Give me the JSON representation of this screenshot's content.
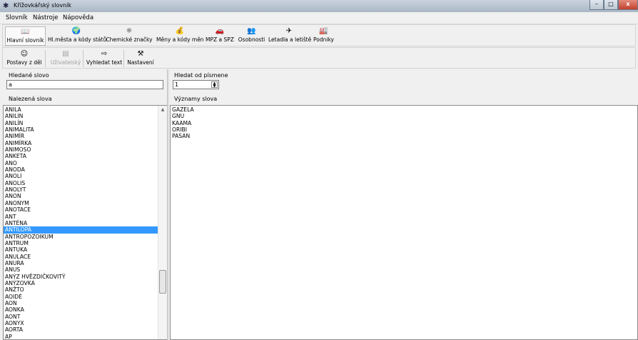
{
  "window": {
    "title": "Křížovkářský slovník",
    "minimize": "–",
    "maximize": "□",
    "close": "x"
  },
  "menu": [
    "Slovník",
    "Nástroje",
    "Nápověda"
  ],
  "toolbar1": [
    {
      "label": "Hlavní slovník",
      "icon": "book-icon",
      "glyph": "📖"
    },
    {
      "label": "Hl.města a kódy států",
      "icon": "globe-icon",
      "glyph": "🌍"
    },
    {
      "label": "Chemické značky",
      "icon": "atom-icon",
      "glyph": "⚛"
    },
    {
      "label": "Měny a kódy měn",
      "icon": "money-bag-icon",
      "glyph": "💰"
    },
    {
      "label": "MPZ a SPZ",
      "icon": "car-icon",
      "glyph": "🚗"
    },
    {
      "label": "Osobnosti",
      "icon": "people-icon",
      "glyph": "👥"
    },
    {
      "label": "Letadla a letiště",
      "icon": "airplane-icon",
      "glyph": "✈"
    },
    {
      "label": "Podniky",
      "icon": "factory-icon",
      "glyph": "🏭"
    }
  ],
  "toolbar2": [
    {
      "label": "Postavy z děl",
      "icon": "character-icon",
      "glyph": "☺"
    },
    {
      "label": "Uživatelský",
      "icon": "user-dictionary-icon",
      "glyph": "▤"
    },
    {
      "label": "Vyhledat text",
      "icon": "search-text-icon",
      "glyph": "⇨"
    },
    {
      "label": "Nastavení",
      "icon": "settings-tools-icon",
      "glyph": "⚒"
    }
  ],
  "search": {
    "label": "Hledané slovo",
    "value": "a"
  },
  "start_letter": {
    "label": "Hledat od písmene",
    "value": "1"
  },
  "found": {
    "label": "Nalezená slova",
    "selected_index": 18,
    "items": [
      "ANILA",
      "ANILIN",
      "ANILÍN",
      "ANIMALITA",
      "ANIMÍR",
      "ANIMÍRKA",
      "ANIMOSO",
      "ANKETA",
      "ANO",
      "ANODA",
      "ANOLI",
      "ANOLIS",
      "ANOLYT",
      "ANON",
      "ANONYM",
      "ANOTACE",
      "ANT",
      "ANTÉNA",
      "ANTILOPA",
      "ANTROPOZOIKUM",
      "ANTRUM",
      "ANTUKA",
      "ANULACE",
      "ANURA",
      "ANUS",
      "ANÝZ HVĚZDIČKOVITÝ",
      "ANÝZOVKA",
      "ANŽTO",
      "AOIDÉ",
      "AON",
      "AONKA",
      "AONT",
      "AONYX",
      "AORTA",
      "AP"
    ]
  },
  "meanings": {
    "label": "Významy slova",
    "items": [
      "GAZELA",
      "GNU",
      "KAAMA",
      "ORIBI",
      "PASAN"
    ]
  }
}
